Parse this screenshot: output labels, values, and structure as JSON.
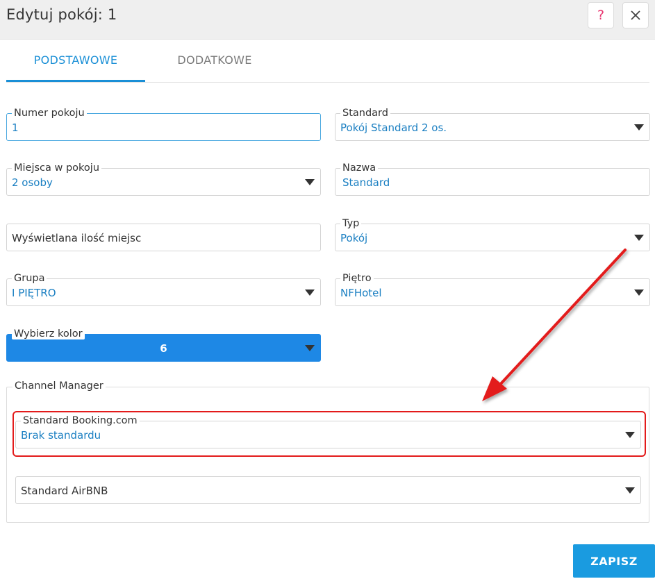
{
  "header": {
    "title": "Edytuj pokój: 1",
    "help_label": "?",
    "close_label": "✕"
  },
  "tabs": [
    {
      "label": "PODSTAWOWE",
      "active": true
    },
    {
      "label": "DODATKOWE",
      "active": false
    }
  ],
  "fields": {
    "room_number": {
      "label": "Numer pokoju",
      "value": "1"
    },
    "standard": {
      "label": "Standard",
      "value": "Pokój Standard 2 os."
    },
    "beds": {
      "label": "Miejsca w pokoju",
      "value": "2 osoby"
    },
    "name": {
      "label": "Nazwa",
      "value": "Standard"
    },
    "displayed_beds": {
      "placeholder": "Wyświetlana ilość miejsc"
    },
    "type": {
      "label": "Typ",
      "value": "Pokój"
    },
    "group": {
      "label": "Grupa",
      "value": "I PIĘTRO"
    },
    "floor": {
      "label": "Piętro",
      "value": "NFHotel"
    },
    "color": {
      "label": "Wybierz kolor",
      "value": "6",
      "color": "#1e88e5"
    }
  },
  "channel_manager": {
    "legend": "Channel Manager",
    "booking": {
      "label": "Standard Booking.com",
      "value": "Brak standardu"
    },
    "airbnb": {
      "placeholder": "Standard AirBNB"
    }
  },
  "footer": {
    "save_label": "ZAPISZ"
  },
  "colors": {
    "accent": "#1a8fd6",
    "annotation": "#e31b1b",
    "save": "#1a9be0"
  }
}
